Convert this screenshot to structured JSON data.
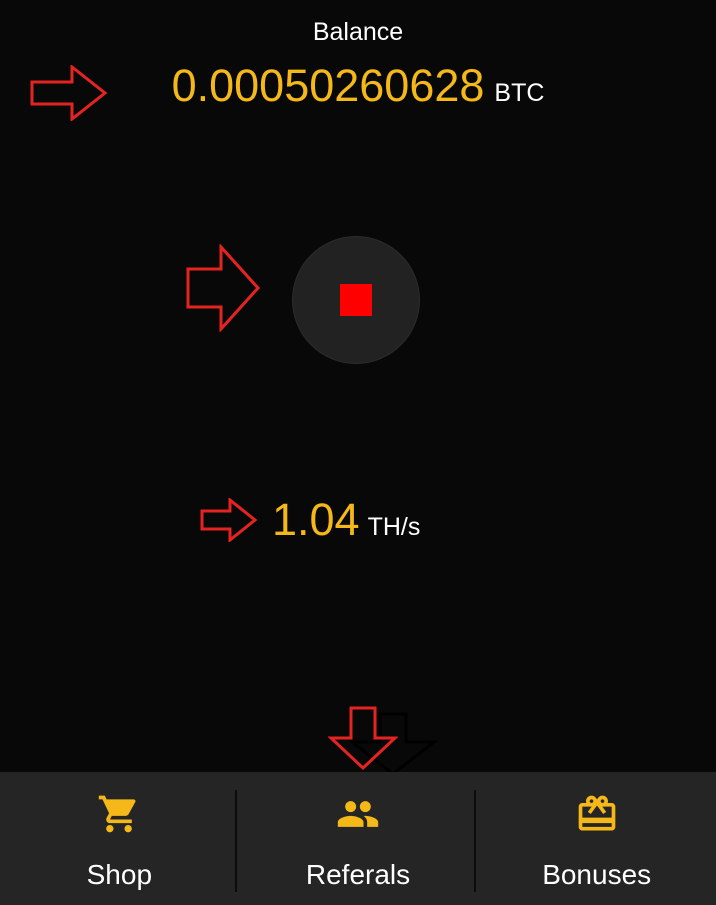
{
  "balance": {
    "label": "Balance",
    "value": "0.00050260628",
    "unit": "BTC"
  },
  "mining_button": {
    "icon": "stop-icon",
    "state": "running"
  },
  "hashrate": {
    "value": "1.04",
    "unit": "TH/s"
  },
  "bottom_nav": {
    "items": [
      {
        "label": "Shop",
        "icon": "cart-icon"
      },
      {
        "label": "Referals",
        "icon": "people-icon"
      },
      {
        "label": "Bonuses",
        "icon": "gift-icon"
      }
    ]
  },
  "colors": {
    "accent": "#f4b818",
    "background": "#080808",
    "nav_background": "#252525",
    "stop": "#ff0000",
    "annotation": "#e52421"
  }
}
